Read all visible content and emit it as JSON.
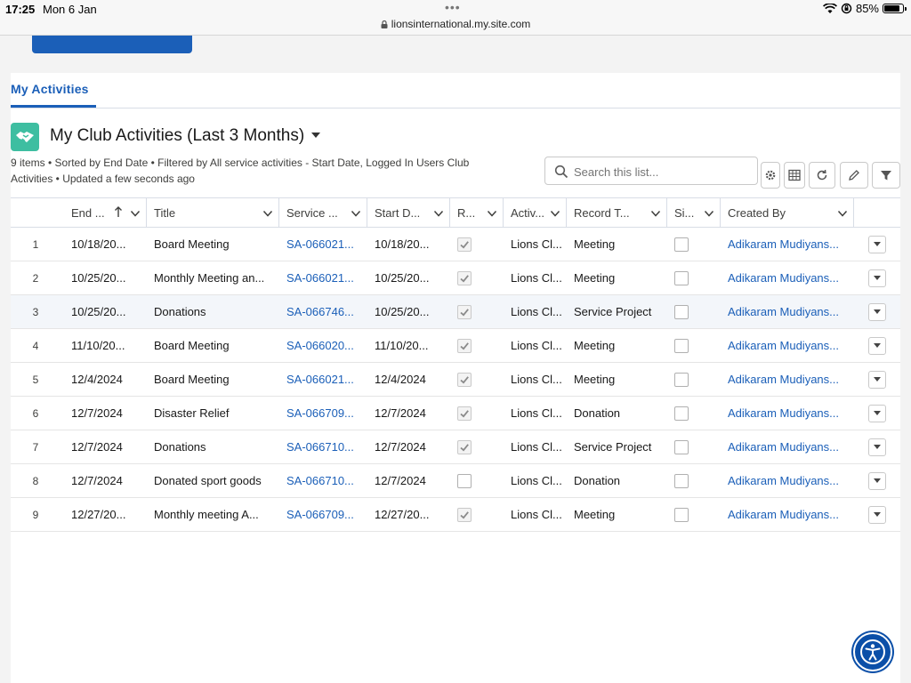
{
  "status_bar": {
    "time": "17:25",
    "date": "Mon 6 Jan",
    "url": "lionsinternational.my.site.com",
    "battery": "85%",
    "battery_level": 0.85
  },
  "tabs": [
    {
      "label": "My Activities",
      "active": true
    }
  ],
  "list_view": {
    "title": "My Club Activities (Last 3 Months)",
    "meta": "9 items • Sorted by End Date • Filtered by All service activities - Start Date, Logged In Users Club Activities • Updated a few seconds ago",
    "icon": "handshake-icon",
    "icon_color": "#3ebea1",
    "search_placeholder": "Search this list..."
  },
  "toolbar": {
    "buttons": [
      "settings-icon",
      "table-display-icon",
      "refresh-icon",
      "edit-icon",
      "filter-icon"
    ]
  },
  "columns": [
    {
      "key": "end_date",
      "label": "End ...",
      "sorted": "asc"
    },
    {
      "key": "title",
      "label": "Title"
    },
    {
      "key": "service",
      "label": "Service ..."
    },
    {
      "key": "start_date",
      "label": "Start D..."
    },
    {
      "key": "r",
      "label": "R..."
    },
    {
      "key": "activity",
      "label": "Activ..."
    },
    {
      "key": "record_type",
      "label": "Record T..."
    },
    {
      "key": "si",
      "label": "Si..."
    },
    {
      "key": "created_by",
      "label": "Created By"
    }
  ],
  "rows": [
    {
      "num": "1",
      "end_date": "10/18/20...",
      "title": "Board Meeting",
      "service": "SA-066021...",
      "start_date": "10/18/20...",
      "r": true,
      "activity": "Lions Cl...",
      "record_type": "Meeting",
      "si": false,
      "created_by": "Adikaram Mudiyans..."
    },
    {
      "num": "2",
      "end_date": "10/25/20...",
      "title": "Monthly Meeting an...",
      "service": "SA-066021...",
      "start_date": "10/25/20...",
      "r": true,
      "activity": "Lions Cl...",
      "record_type": "Meeting",
      "si": false,
      "created_by": "Adikaram Mudiyans..."
    },
    {
      "num": "3",
      "end_date": "10/25/20...",
      "title": "Donations",
      "service": "SA-066746...",
      "start_date": "10/25/20...",
      "r": true,
      "activity": "Lions Cl...",
      "record_type": "Service Project",
      "si": false,
      "created_by": "Adikaram Mudiyans...",
      "highlighted": true
    },
    {
      "num": "4",
      "end_date": "11/10/20...",
      "title": "Board Meeting",
      "service": "SA-066020...",
      "start_date": "11/10/20...",
      "r": true,
      "activity": "Lions Cl...",
      "record_type": "Meeting",
      "si": false,
      "created_by": "Adikaram Mudiyans..."
    },
    {
      "num": "5",
      "end_date": "12/4/2024",
      "title": "Board Meeting",
      "service": "SA-066021...",
      "start_date": "12/4/2024",
      "r": true,
      "activity": "Lions Cl...",
      "record_type": "Meeting",
      "si": false,
      "created_by": "Adikaram Mudiyans..."
    },
    {
      "num": "6",
      "end_date": "12/7/2024",
      "title": "Disaster Relief",
      "service": "SA-066709...",
      "start_date": "12/7/2024",
      "r": true,
      "activity": "Lions Cl...",
      "record_type": "Donation",
      "si": false,
      "created_by": "Adikaram Mudiyans..."
    },
    {
      "num": "7",
      "end_date": "12/7/2024",
      "title": "Donations",
      "service": "SA-066710...",
      "start_date": "12/7/2024",
      "r": true,
      "activity": "Lions Cl...",
      "record_type": "Service Project",
      "si": false,
      "created_by": "Adikaram Mudiyans..."
    },
    {
      "num": "8",
      "end_date": "12/7/2024",
      "title": "Donated sport goods",
      "service": "SA-066710...",
      "start_date": "12/7/2024",
      "r": false,
      "activity": "Lions Cl...",
      "record_type": "Donation",
      "si": false,
      "created_by": "Adikaram Mudiyans..."
    },
    {
      "num": "9",
      "end_date": "12/27/20...",
      "title": "Monthly meeting A...",
      "service": "SA-066709...",
      "start_date": "12/27/20...",
      "r": true,
      "activity": "Lions Cl...",
      "record_type": "Meeting",
      "si": false,
      "created_by": "Adikaram Mudiyans..."
    }
  ],
  "colors": {
    "brand_blue": "#1b5fb8",
    "link": "#1b5fb8",
    "accessibility_button": "#0b4fa8"
  },
  "accessibility_button_icon": "accessibility-icon"
}
